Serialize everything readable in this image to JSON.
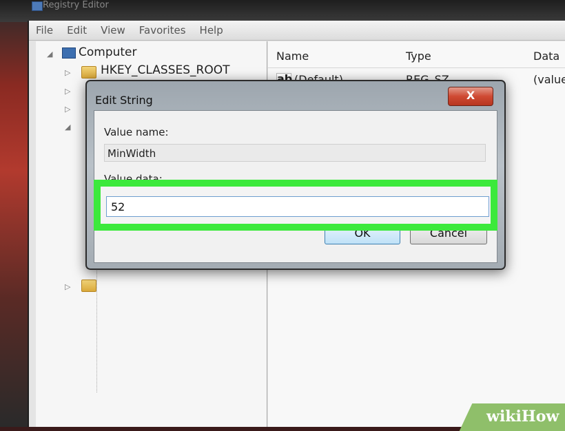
{
  "window": {
    "title": "Registry Editor"
  },
  "menu": [
    "File",
    "Edit",
    "View",
    "Favorites",
    "Help"
  ],
  "tree": {
    "root": "Computer",
    "items": [
      "HKEY_CLASSES_ROOT"
    ]
  },
  "list": {
    "headers": {
      "name": "Name",
      "type": "Type",
      "data": "Data"
    },
    "rows": [
      {
        "name": "(Default)",
        "type": "REG_SZ",
        "data": "(value"
      }
    ]
  },
  "dialog": {
    "title": "Edit String",
    "close_label": "X",
    "value_name_label": "Value name:",
    "value_name": "MinWidth",
    "value_data_label": "Value data:",
    "value_data": "52",
    "ok_label": "OK",
    "cancel_label": "Cancel"
  },
  "watermark": {
    "wiki": "wiki",
    "how": "How"
  },
  "colors": {
    "highlight": "#3ce93c",
    "close_button": "#cf4a33",
    "watermark": "#8fbf6a"
  }
}
